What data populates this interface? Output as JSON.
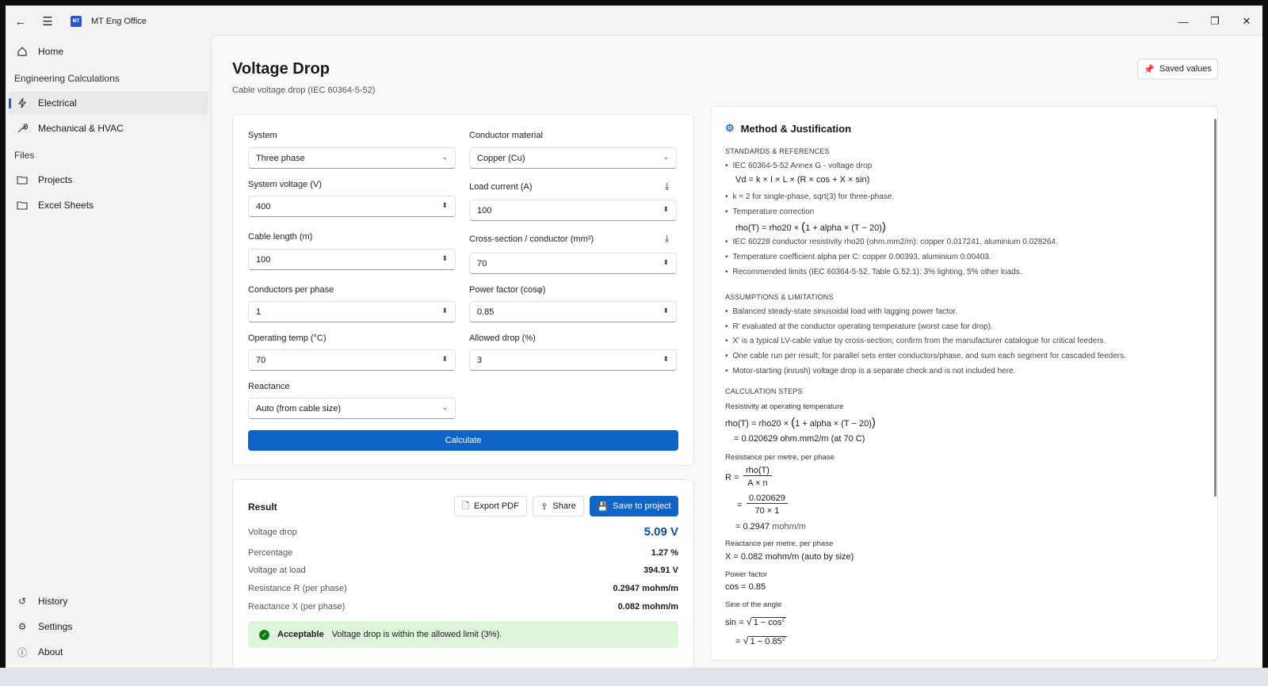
{
  "app": {
    "title": "MT Eng Office",
    "logo": "MT"
  },
  "sidebar": {
    "home": "Home",
    "section_calc": "Engineering Calculations",
    "electrical": "Electrical",
    "mech": "Mechanical & HVAC",
    "section_files": "Files",
    "projects": "Projects",
    "excel": "Excel Sheets",
    "history": "History",
    "settings": "Settings",
    "about": "About"
  },
  "page": {
    "title": "Voltage Drop",
    "subtitle": "Cable voltage drop (IEC 60364-5-52)",
    "saved_values": "Saved values"
  },
  "form": {
    "system_label": "System",
    "system_value": "Three phase",
    "material_label": "Conductor material",
    "material_value": "Copper (Cu)",
    "voltage_label": "System voltage (V)",
    "voltage_value": "400",
    "current_label": "Load current (A)",
    "current_value": "100",
    "length_label": "Cable length (m)",
    "length_value": "100",
    "cross_label": "Cross-section / conductor (mm²)",
    "cross_value": "70",
    "cpp_label": "Conductors per phase",
    "cpp_value": "1",
    "pf_label": "Power factor (cosφ)",
    "pf_value": "0.85",
    "temp_label": "Operating temp (°C)",
    "temp_value": "70",
    "drop_label": "Allowed drop (%)",
    "drop_value": "3",
    "react_label": "Reactance",
    "react_value": "Auto (from cable size)",
    "calculate": "Calculate"
  },
  "result": {
    "title": "Result",
    "export": "Export PDF",
    "share": "Share",
    "save": "Save to project",
    "rows": [
      {
        "label": "Voltage drop",
        "value": "5.09 V"
      },
      {
        "label": "Percentage",
        "value": "1.27 %"
      },
      {
        "label": "Voltage at load",
        "value": "394.91 V"
      },
      {
        "label": "Resistance R (per phase)",
        "value": "0.2947 mohm/m"
      },
      {
        "label": "Reactance X (per phase)",
        "value": "0.082 mohm/m"
      }
    ],
    "status": "Acceptable",
    "status_msg": "Voltage drop is within the allowed limit (3%)."
  },
  "method": {
    "title": "Method & Justification",
    "sec_std": "STANDARDS & REFERENCES",
    "b1": "IEC 60364-5-52 Annex G - voltage drop",
    "f1": "Vd = k × I × L × (R × cos + X × sin)",
    "b2": "k = 2 for single-phase, sqrt(3) for three-phase.",
    "b3": "Temperature correction",
    "f2a": "rho(T) = rho20 × ",
    "f2b": "1 + alpha × (T − 20)",
    "b4": "IEC 60228 conductor resistivity rho20 (ohm.mm2/m): copper 0.017241, aluminium 0.028264.",
    "b5": "Temperature coefficient alpha per C: copper 0.00393, aluminium 0.00403.",
    "b6": "Recommended limits (IEC 60364-5-52, Table G.52.1): 3% lighting, 5% other loads.",
    "sec_asm": "ASSUMPTIONS & LIMITATIONS",
    "a1": "Balanced steady-state sinusoidal load with lagging power factor.",
    "a2": "R' evaluated at the conductor operating temperature (worst case for drop).",
    "a3": "X' is a typical LV-cable value by cross-section; confirm from the manufacturer catalogue for critical feeders.",
    "a4": "One cable run per result; for parallel sets enter conductors/phase, and sum each segment for cascaded feeders.",
    "a5": "Motor-starting (inrush) voltage drop is a separate check and is not included here.",
    "sec_steps": "CALCULATION STEPS",
    "s1": "Resistivity at operating temperature",
    "s1f": "rho(T) = rho20 × ",
    "s1f2": "1 + alpha × (T − 20)",
    "s1r": "= 0.020629 ohm.mm2/m   (at 70 C)",
    "s2": "Resistance per metre, per phase",
    "s2R": "R =",
    "s2n1": "rho(T)",
    "s2d1": "A × n",
    "s2eq": "=",
    "s2n2": "0.020629",
    "s2d2": "70 × 1",
    "s2r": "= 0.2947",
    "s2u": "mohm/m",
    "s3": "Reactance per metre, per phase",
    "s3f": "X = 0.082 mohm/m   (auto by size)",
    "s4": "Power factor",
    "s4f": "cos = 0.85",
    "s5": "Sine of the angle",
    "s5a": "sin =",
    "s5b": "1 − cos",
    "s5c": "= ",
    "s5d": "1 − 0.85"
  }
}
